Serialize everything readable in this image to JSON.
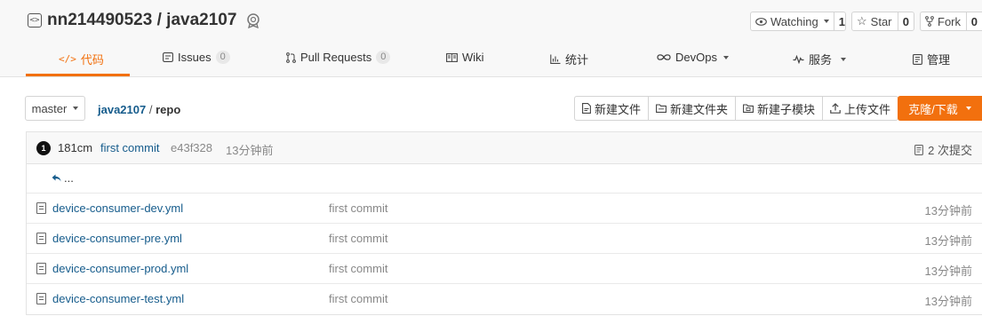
{
  "repo": {
    "owner": "nn214490523",
    "separator": "/",
    "name": "java2107"
  },
  "actions": {
    "watching": {
      "label": "Watching",
      "count": "1"
    },
    "star": {
      "label": "Star",
      "count": "0"
    },
    "fork": {
      "label": "Fork",
      "count": "0"
    }
  },
  "tabs": [
    {
      "label": "代码",
      "icon": "code-icon"
    },
    {
      "label": "Issues",
      "count": "0",
      "icon": "issues-icon"
    },
    {
      "label": "Pull Requests",
      "count": "0",
      "icon": "pull-request-icon"
    },
    {
      "label": "Wiki",
      "icon": "wiki-icon"
    },
    {
      "label": "统计",
      "icon": "stats-icon"
    },
    {
      "label": "DevOps",
      "icon": "devops-icon"
    },
    {
      "label": "服务",
      "icon": "service-icon"
    },
    {
      "label": "管理",
      "icon": "manage-icon"
    }
  ],
  "branch": {
    "label": "master"
  },
  "breadcrumb": {
    "root": "java2107",
    "separator": "/",
    "current": "repo"
  },
  "toolbar": {
    "new_file": "新建文件",
    "new_folder": "新建文件夹",
    "new_submodule": "新建子模块",
    "upload": "上传文件",
    "clone": "克隆/下载"
  },
  "last_commit": {
    "avatar_text": "1",
    "author": "181cm",
    "message": "first commit",
    "hash": "e43f328",
    "time": "13分钟前",
    "commit_count": "2 次提交"
  },
  "parent_dir": "...",
  "files": [
    {
      "name": "device-consumer-dev.yml",
      "message": "first commit",
      "time": "13分钟前"
    },
    {
      "name": "device-consumer-pre.yml",
      "message": "first commit",
      "time": "13分钟前"
    },
    {
      "name": "device-consumer-prod.yml",
      "message": "first commit",
      "time": "13分钟前"
    },
    {
      "name": "device-consumer-test.yml",
      "message": "first commit",
      "time": "13分钟前"
    }
  ],
  "colors": {
    "accent": "#f2700e",
    "link": "#165c8c"
  }
}
